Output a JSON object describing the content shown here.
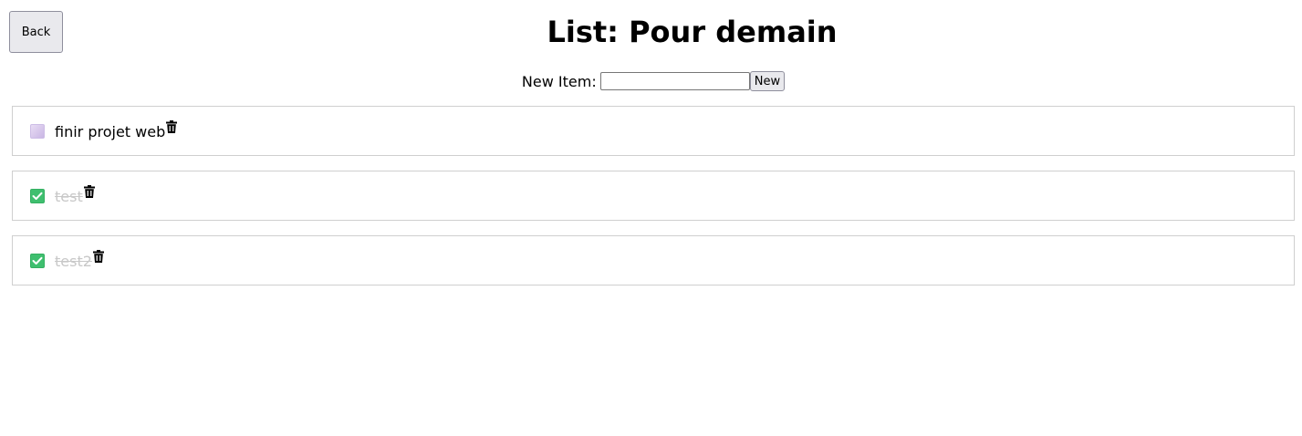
{
  "header": {
    "back_label": "Back",
    "title": "List: Pour demain"
  },
  "new_item": {
    "label": "New Item:",
    "input_value": "",
    "button_label": "New"
  },
  "items": [
    {
      "text": "finir projet web",
      "done": false,
      "delete_icon": "trash-icon"
    },
    {
      "text": "test",
      "done": true,
      "delete_icon": "trash-icon"
    },
    {
      "text": "test2",
      "done": true,
      "delete_icon": "trash-icon"
    }
  ],
  "colors": {
    "checked": "#3fbf6f",
    "unchecked": "#c9b6e4",
    "done_text": "#c8c8c8"
  }
}
